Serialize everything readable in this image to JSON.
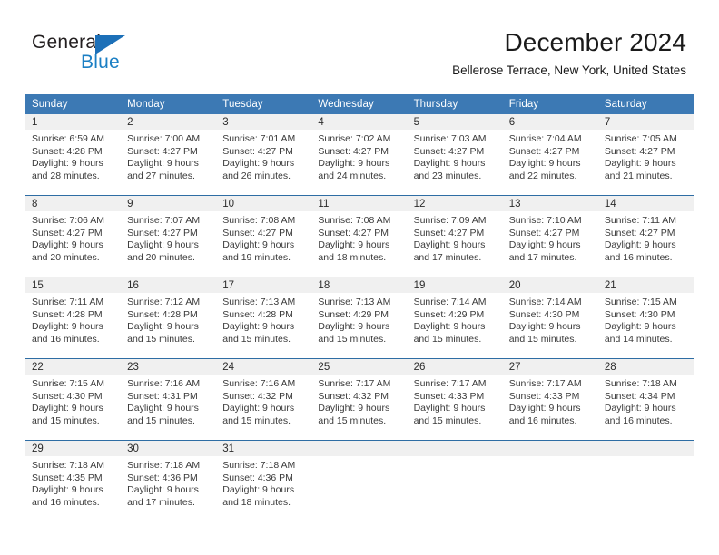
{
  "brand": {
    "word_one": "General",
    "word_two": "Blue",
    "triangle_icon": "triangle-logo-icon"
  },
  "header": {
    "title": "December 2024",
    "location": "Bellerose Terrace, New York, United States"
  },
  "colors": {
    "header_blue": "#3c79b4",
    "row_divider_blue": "#2e6da4",
    "date_band_gray": "#f0f0f0",
    "brand_blue": "#1b7fc4",
    "text": "#3a3a3a"
  },
  "weekdays": [
    "Sunday",
    "Monday",
    "Tuesday",
    "Wednesday",
    "Thursday",
    "Friday",
    "Saturday"
  ],
  "labels": {
    "sunrise_prefix": "Sunrise:",
    "sunset_prefix": "Sunset:",
    "daylight_prefix": "Daylight:"
  },
  "weeks": [
    [
      {
        "day": "1",
        "sunrise": "Sunrise: 6:59 AM",
        "sunset": "Sunset: 4:28 PM",
        "daylight_line1": "Daylight: 9 hours",
        "daylight_line2": "and 28 minutes."
      },
      {
        "day": "2",
        "sunrise": "Sunrise: 7:00 AM",
        "sunset": "Sunset: 4:27 PM",
        "daylight_line1": "Daylight: 9 hours",
        "daylight_line2": "and 27 minutes."
      },
      {
        "day": "3",
        "sunrise": "Sunrise: 7:01 AM",
        "sunset": "Sunset: 4:27 PM",
        "daylight_line1": "Daylight: 9 hours",
        "daylight_line2": "and 26 minutes."
      },
      {
        "day": "4",
        "sunrise": "Sunrise: 7:02 AM",
        "sunset": "Sunset: 4:27 PM",
        "daylight_line1": "Daylight: 9 hours",
        "daylight_line2": "and 24 minutes."
      },
      {
        "day": "5",
        "sunrise": "Sunrise: 7:03 AM",
        "sunset": "Sunset: 4:27 PM",
        "daylight_line1": "Daylight: 9 hours",
        "daylight_line2": "and 23 minutes."
      },
      {
        "day": "6",
        "sunrise": "Sunrise: 7:04 AM",
        "sunset": "Sunset: 4:27 PM",
        "daylight_line1": "Daylight: 9 hours",
        "daylight_line2": "and 22 minutes."
      },
      {
        "day": "7",
        "sunrise": "Sunrise: 7:05 AM",
        "sunset": "Sunset: 4:27 PM",
        "daylight_line1": "Daylight: 9 hours",
        "daylight_line2": "and 21 minutes."
      }
    ],
    [
      {
        "day": "8",
        "sunrise": "Sunrise: 7:06 AM",
        "sunset": "Sunset: 4:27 PM",
        "daylight_line1": "Daylight: 9 hours",
        "daylight_line2": "and 20 minutes."
      },
      {
        "day": "9",
        "sunrise": "Sunrise: 7:07 AM",
        "sunset": "Sunset: 4:27 PM",
        "daylight_line1": "Daylight: 9 hours",
        "daylight_line2": "and 20 minutes."
      },
      {
        "day": "10",
        "sunrise": "Sunrise: 7:08 AM",
        "sunset": "Sunset: 4:27 PM",
        "daylight_line1": "Daylight: 9 hours",
        "daylight_line2": "and 19 minutes."
      },
      {
        "day": "11",
        "sunrise": "Sunrise: 7:08 AM",
        "sunset": "Sunset: 4:27 PM",
        "daylight_line1": "Daylight: 9 hours",
        "daylight_line2": "and 18 minutes."
      },
      {
        "day": "12",
        "sunrise": "Sunrise: 7:09 AM",
        "sunset": "Sunset: 4:27 PM",
        "daylight_line1": "Daylight: 9 hours",
        "daylight_line2": "and 17 minutes."
      },
      {
        "day": "13",
        "sunrise": "Sunrise: 7:10 AM",
        "sunset": "Sunset: 4:27 PM",
        "daylight_line1": "Daylight: 9 hours",
        "daylight_line2": "and 17 minutes."
      },
      {
        "day": "14",
        "sunrise": "Sunrise: 7:11 AM",
        "sunset": "Sunset: 4:27 PM",
        "daylight_line1": "Daylight: 9 hours",
        "daylight_line2": "and 16 minutes."
      }
    ],
    [
      {
        "day": "15",
        "sunrise": "Sunrise: 7:11 AM",
        "sunset": "Sunset: 4:28 PM",
        "daylight_line1": "Daylight: 9 hours",
        "daylight_line2": "and 16 minutes."
      },
      {
        "day": "16",
        "sunrise": "Sunrise: 7:12 AM",
        "sunset": "Sunset: 4:28 PM",
        "daylight_line1": "Daylight: 9 hours",
        "daylight_line2": "and 15 minutes."
      },
      {
        "day": "17",
        "sunrise": "Sunrise: 7:13 AM",
        "sunset": "Sunset: 4:28 PM",
        "daylight_line1": "Daylight: 9 hours",
        "daylight_line2": "and 15 minutes."
      },
      {
        "day": "18",
        "sunrise": "Sunrise: 7:13 AM",
        "sunset": "Sunset: 4:29 PM",
        "daylight_line1": "Daylight: 9 hours",
        "daylight_line2": "and 15 minutes."
      },
      {
        "day": "19",
        "sunrise": "Sunrise: 7:14 AM",
        "sunset": "Sunset: 4:29 PM",
        "daylight_line1": "Daylight: 9 hours",
        "daylight_line2": "and 15 minutes."
      },
      {
        "day": "20",
        "sunrise": "Sunrise: 7:14 AM",
        "sunset": "Sunset: 4:30 PM",
        "daylight_line1": "Daylight: 9 hours",
        "daylight_line2": "and 15 minutes."
      },
      {
        "day": "21",
        "sunrise": "Sunrise: 7:15 AM",
        "sunset": "Sunset: 4:30 PM",
        "daylight_line1": "Daylight: 9 hours",
        "daylight_line2": "and 14 minutes."
      }
    ],
    [
      {
        "day": "22",
        "sunrise": "Sunrise: 7:15 AM",
        "sunset": "Sunset: 4:30 PM",
        "daylight_line1": "Daylight: 9 hours",
        "daylight_line2": "and 15 minutes."
      },
      {
        "day": "23",
        "sunrise": "Sunrise: 7:16 AM",
        "sunset": "Sunset: 4:31 PM",
        "daylight_line1": "Daylight: 9 hours",
        "daylight_line2": "and 15 minutes."
      },
      {
        "day": "24",
        "sunrise": "Sunrise: 7:16 AM",
        "sunset": "Sunset: 4:32 PM",
        "daylight_line1": "Daylight: 9 hours",
        "daylight_line2": "and 15 minutes."
      },
      {
        "day": "25",
        "sunrise": "Sunrise: 7:17 AM",
        "sunset": "Sunset: 4:32 PM",
        "daylight_line1": "Daylight: 9 hours",
        "daylight_line2": "and 15 minutes."
      },
      {
        "day": "26",
        "sunrise": "Sunrise: 7:17 AM",
        "sunset": "Sunset: 4:33 PM",
        "daylight_line1": "Daylight: 9 hours",
        "daylight_line2": "and 15 minutes."
      },
      {
        "day": "27",
        "sunrise": "Sunrise: 7:17 AM",
        "sunset": "Sunset: 4:33 PM",
        "daylight_line1": "Daylight: 9 hours",
        "daylight_line2": "and 16 minutes."
      },
      {
        "day": "28",
        "sunrise": "Sunrise: 7:18 AM",
        "sunset": "Sunset: 4:34 PM",
        "daylight_line1": "Daylight: 9 hours",
        "daylight_line2": "and 16 minutes."
      }
    ],
    [
      {
        "day": "29",
        "sunrise": "Sunrise: 7:18 AM",
        "sunset": "Sunset: 4:35 PM",
        "daylight_line1": "Daylight: 9 hours",
        "daylight_line2": "and 16 minutes."
      },
      {
        "day": "30",
        "sunrise": "Sunrise: 7:18 AM",
        "sunset": "Sunset: 4:36 PM",
        "daylight_line1": "Daylight: 9 hours",
        "daylight_line2": "and 17 minutes."
      },
      {
        "day": "31",
        "sunrise": "Sunrise: 7:18 AM",
        "sunset": "Sunset: 4:36 PM",
        "daylight_line1": "Daylight: 9 hours",
        "daylight_line2": "and 18 minutes."
      },
      {
        "day": "",
        "sunrise": "",
        "sunset": "",
        "daylight_line1": "",
        "daylight_line2": ""
      },
      {
        "day": "",
        "sunrise": "",
        "sunset": "",
        "daylight_line1": "",
        "daylight_line2": ""
      },
      {
        "day": "",
        "sunrise": "",
        "sunset": "",
        "daylight_line1": "",
        "daylight_line2": ""
      },
      {
        "day": "",
        "sunrise": "",
        "sunset": "",
        "daylight_line1": "",
        "daylight_line2": ""
      }
    ]
  ]
}
